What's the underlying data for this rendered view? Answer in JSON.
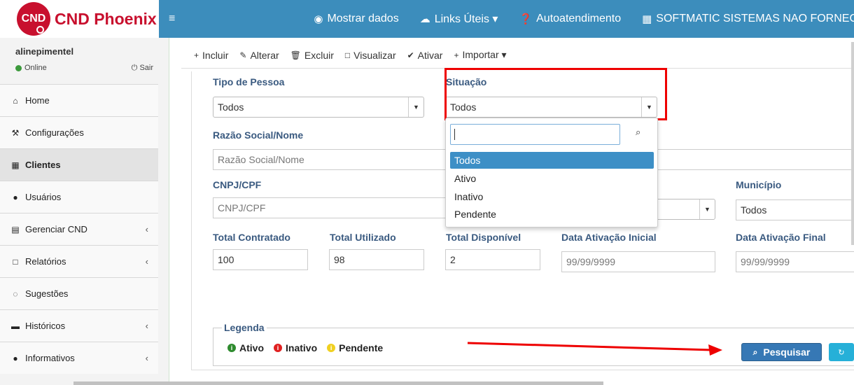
{
  "brand": {
    "logo_text": "CND",
    "name": "CND Phoenix"
  },
  "user": {
    "name": "alinepimentel",
    "status": "Online",
    "logout": "Sair"
  },
  "menu": [
    {
      "label": "Home",
      "icon": "home-icon",
      "glyph": "⌂"
    },
    {
      "label": "Configurações",
      "icon": "wrench-icon",
      "glyph": "🔧"
    },
    {
      "label": "Clientes",
      "icon": "building-icon",
      "glyph": "▦"
    },
    {
      "label": "Usuários",
      "icon": "user-icon",
      "glyph": "●"
    },
    {
      "label": "Gerenciar CND",
      "icon": "calendar-icon",
      "glyph": "▤"
    },
    {
      "label": "Relatórios",
      "icon": "file-icon",
      "glyph": "□"
    },
    {
      "label": "Sugestões",
      "icon": "comments-icon",
      "glyph": "◌"
    },
    {
      "label": "Históricos",
      "icon": "archive-icon",
      "glyph": "▬"
    },
    {
      "label": "Informativos",
      "icon": "info-icon",
      "glyph": "●"
    }
  ],
  "topnav": {
    "menu_toggle": "≡",
    "links": [
      {
        "label": "Mostrar dados",
        "icon": "eye-icon"
      },
      {
        "label": "Links Úteis ▾",
        "icon": "cloud-icon"
      },
      {
        "label": "Autoatendimento",
        "icon": "question-icon"
      },
      {
        "label": "SOFTMATIC SISTEMAS NAO FORNEC",
        "icon": "building-icon"
      }
    ]
  },
  "toolbar": [
    {
      "label": "Incluir",
      "icon": "plus-icon",
      "glyph": "+"
    },
    {
      "label": "Alterar",
      "icon": "pencil-icon",
      "glyph": "✎"
    },
    {
      "label": "Excluir",
      "icon": "trash-icon",
      "glyph": "␡"
    },
    {
      "label": "Visualizar",
      "icon": "file-icon",
      "glyph": "□"
    },
    {
      "label": "Ativar",
      "icon": "check-icon",
      "glyph": "✔"
    },
    {
      "label": "Importar ▾",
      "icon": "plus-icon",
      "glyph": "+"
    }
  ],
  "form": {
    "tipo_pessoa": {
      "label": "Tipo de Pessoa",
      "value": "Todos"
    },
    "situacao": {
      "label": "Situação",
      "value": "Todos"
    },
    "razao": {
      "label": "Razão Social/Nome",
      "placeholder": "Razão Social/Nome"
    },
    "cnpj": {
      "label": "CNPJ/CPF",
      "placeholder": "CNPJ/CPF"
    },
    "municipio": {
      "label": "Município",
      "value": "Todos"
    },
    "total_contratado": {
      "label": "Total Contratado",
      "value": "100"
    },
    "total_utilizado": {
      "label": "Total Utilizado",
      "value": "98"
    },
    "total_disponivel": {
      "label": "Total Disponível",
      "value": "2"
    },
    "data_inicial": {
      "label": "Data Ativação Inicial",
      "placeholder": "99/99/9999"
    },
    "data_final": {
      "label": "Data Ativação Final",
      "placeholder": "99/99/9999"
    }
  },
  "dropdown": {
    "search_value": "",
    "options": [
      "Todos",
      "Ativo",
      "Inativo",
      "Pendente"
    ],
    "selected": "Todos"
  },
  "legend": {
    "title": "Legenda",
    "items": [
      {
        "label": "Ativo",
        "color": "#2e8b2e"
      },
      {
        "label": "Inativo",
        "color": "#e02020"
      },
      {
        "label": "Pendente",
        "color": "#f0d020"
      }
    ]
  },
  "actions": {
    "search_label": "Pesquisar"
  },
  "colors": {
    "primary": "#3c8dbc",
    "brand_red": "#c8102e",
    "highlight": "#ee0000",
    "button": "#3678b5"
  }
}
